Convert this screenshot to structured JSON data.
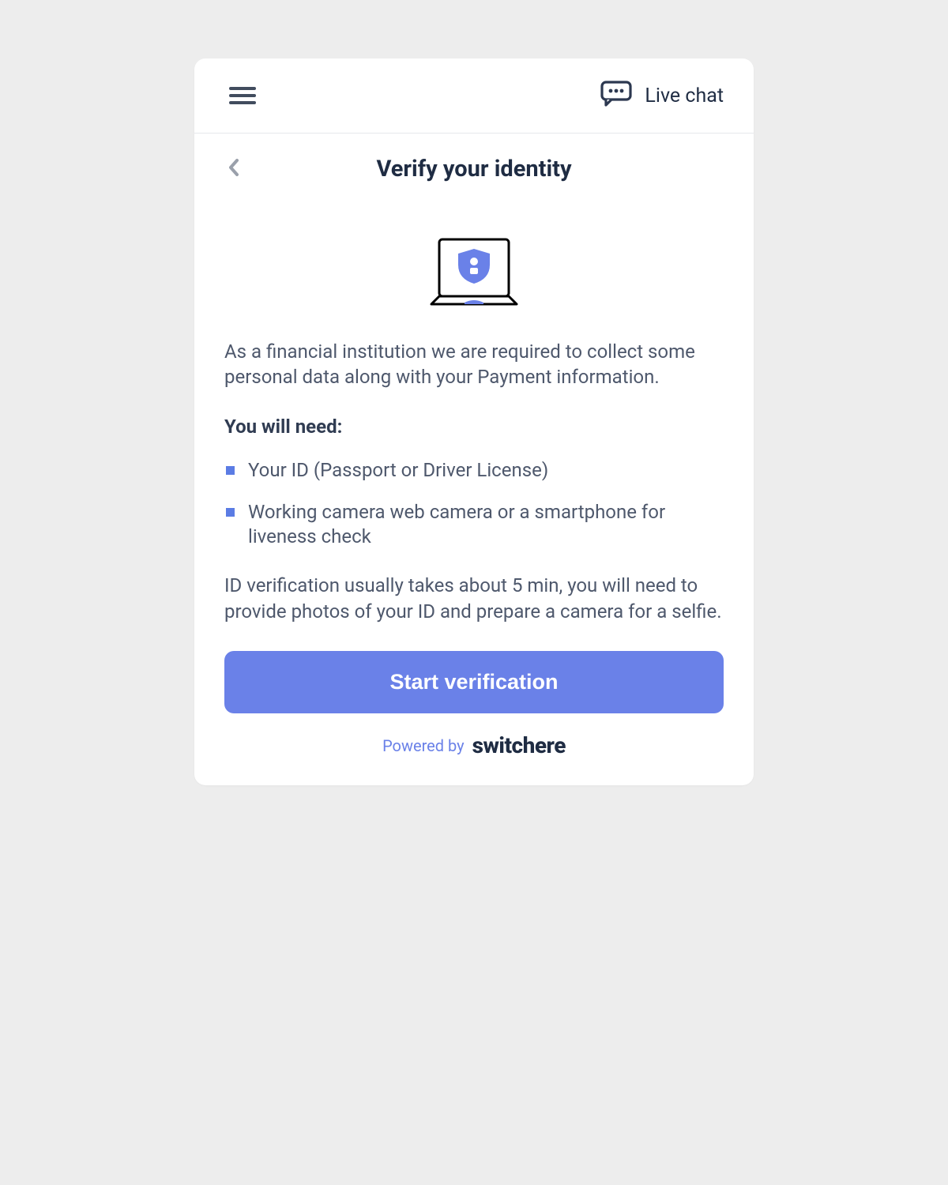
{
  "header": {
    "live_chat_label": "Live chat"
  },
  "page": {
    "title": "Verify your identity",
    "intro": "As a financial institution we are required to collect some personal data along with your Payment information.",
    "need_heading": "You will need:",
    "need_items": [
      "Your ID (Passport or Driver License)",
      "Working camera web camera or a smartphone for liveness check"
    ],
    "note": "ID verification usually takes about 5 min, you will need to provide photos of your ID and prepare a camera for a selfie.",
    "cta_label": "Start verification"
  },
  "footer": {
    "powered_by": "Powered by",
    "brand": "switchere"
  },
  "colors": {
    "accent": "#6a81e8",
    "text_dark": "#1f2c43",
    "text_body": "#4e586c"
  }
}
